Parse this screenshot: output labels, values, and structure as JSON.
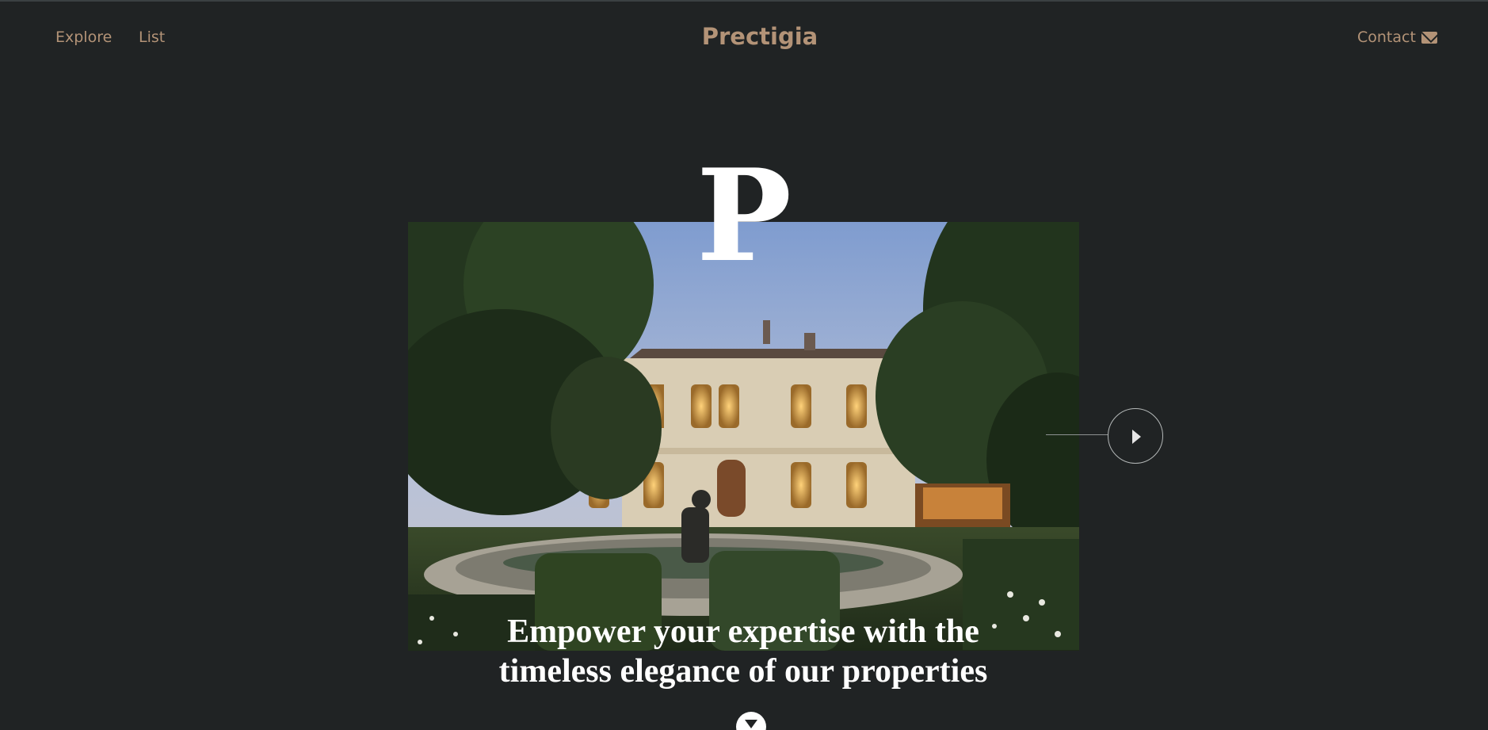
{
  "nav": {
    "explore_label": "Explore",
    "list_label": "List",
    "brand": "Prectigia",
    "contact_label": "Contact",
    "contact_icon": "envelope-icon"
  },
  "hero": {
    "big_letter": "P",
    "tagline": "Empower your expertise with the timeless elegance of our properties",
    "image_subject": "chateau-with-fountain-garden",
    "next_icon": "play-arrow-icon",
    "scroll_icon": "triangle-down-icon"
  },
  "colors": {
    "background": "#202324",
    "accent": "#b39377",
    "text": "#ffffff"
  }
}
